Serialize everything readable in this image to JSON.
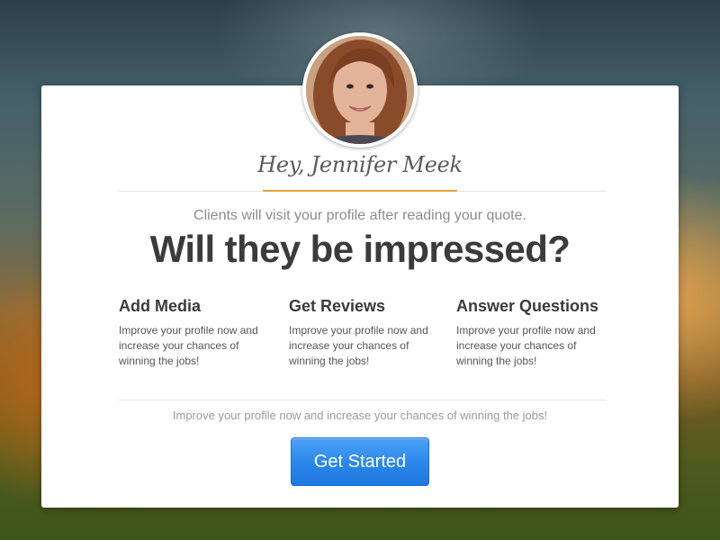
{
  "profile": {
    "greeting": "Hey, Jennifer Meek"
  },
  "intro": {
    "subtitle": "Clients will visit your profile after reading your quote.",
    "headline": "Will they be impressed?"
  },
  "features": [
    {
      "title": "Add Media",
      "description": "Improve your profile now and increase your chances of winning the jobs!"
    },
    {
      "title": "Get Reviews",
      "description": "Improve your profile now and increase your chances of winning the jobs!"
    },
    {
      "title": "Answer Questions",
      "description": "Improve your profile now and increase your chances of winning the jobs!"
    }
  ],
  "footer": {
    "text": "Improve your profile now and increase your chances of winning the jobs!"
  },
  "cta": {
    "label": "Get Started"
  },
  "colors": {
    "accent_orange": "#e7a13b",
    "button_blue": "#2a86ea",
    "headline": "#3b3b3b"
  }
}
